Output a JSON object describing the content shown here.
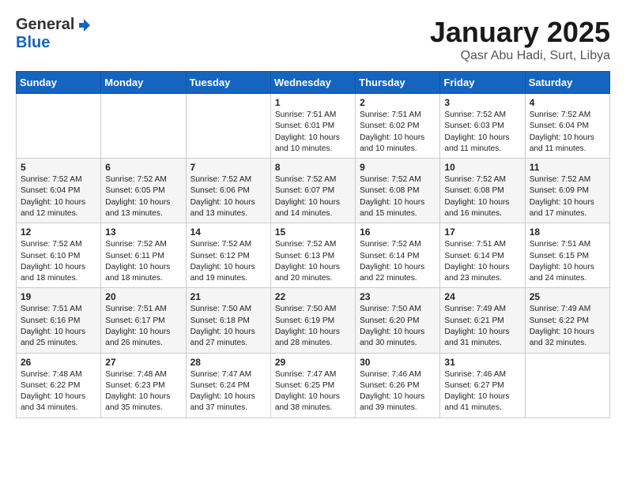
{
  "header": {
    "logo": {
      "general": "General",
      "blue": "Blue",
      "icon": "▶"
    },
    "title": "January 2025",
    "location": "Qasr Abu Hadi, Surt, Libya"
  },
  "calendar": {
    "days_of_week": [
      "Sunday",
      "Monday",
      "Tuesday",
      "Wednesday",
      "Thursday",
      "Friday",
      "Saturday"
    ],
    "weeks": [
      [
        {
          "day": "",
          "info": ""
        },
        {
          "day": "",
          "info": ""
        },
        {
          "day": "",
          "info": ""
        },
        {
          "day": "1",
          "info": "Sunrise: 7:51 AM\nSunset: 6:01 PM\nDaylight: 10 hours\nand 10 minutes."
        },
        {
          "day": "2",
          "info": "Sunrise: 7:51 AM\nSunset: 6:02 PM\nDaylight: 10 hours\nand 10 minutes."
        },
        {
          "day": "3",
          "info": "Sunrise: 7:52 AM\nSunset: 6:03 PM\nDaylight: 10 hours\nand 11 minutes."
        },
        {
          "day": "4",
          "info": "Sunrise: 7:52 AM\nSunset: 6:04 PM\nDaylight: 10 hours\nand 11 minutes."
        }
      ],
      [
        {
          "day": "5",
          "info": "Sunrise: 7:52 AM\nSunset: 6:04 PM\nDaylight: 10 hours\nand 12 minutes."
        },
        {
          "day": "6",
          "info": "Sunrise: 7:52 AM\nSunset: 6:05 PM\nDaylight: 10 hours\nand 13 minutes."
        },
        {
          "day": "7",
          "info": "Sunrise: 7:52 AM\nSunset: 6:06 PM\nDaylight: 10 hours\nand 13 minutes."
        },
        {
          "day": "8",
          "info": "Sunrise: 7:52 AM\nSunset: 6:07 PM\nDaylight: 10 hours\nand 14 minutes."
        },
        {
          "day": "9",
          "info": "Sunrise: 7:52 AM\nSunset: 6:08 PM\nDaylight: 10 hours\nand 15 minutes."
        },
        {
          "day": "10",
          "info": "Sunrise: 7:52 AM\nSunset: 6:08 PM\nDaylight: 10 hours\nand 16 minutes."
        },
        {
          "day": "11",
          "info": "Sunrise: 7:52 AM\nSunset: 6:09 PM\nDaylight: 10 hours\nand 17 minutes."
        }
      ],
      [
        {
          "day": "12",
          "info": "Sunrise: 7:52 AM\nSunset: 6:10 PM\nDaylight: 10 hours\nand 18 minutes."
        },
        {
          "day": "13",
          "info": "Sunrise: 7:52 AM\nSunset: 6:11 PM\nDaylight: 10 hours\nand 18 minutes."
        },
        {
          "day": "14",
          "info": "Sunrise: 7:52 AM\nSunset: 6:12 PM\nDaylight: 10 hours\nand 19 minutes."
        },
        {
          "day": "15",
          "info": "Sunrise: 7:52 AM\nSunset: 6:13 PM\nDaylight: 10 hours\nand 20 minutes."
        },
        {
          "day": "16",
          "info": "Sunrise: 7:52 AM\nSunset: 6:14 PM\nDaylight: 10 hours\nand 22 minutes."
        },
        {
          "day": "17",
          "info": "Sunrise: 7:51 AM\nSunset: 6:14 PM\nDaylight: 10 hours\nand 23 minutes."
        },
        {
          "day": "18",
          "info": "Sunrise: 7:51 AM\nSunset: 6:15 PM\nDaylight: 10 hours\nand 24 minutes."
        }
      ],
      [
        {
          "day": "19",
          "info": "Sunrise: 7:51 AM\nSunset: 6:16 PM\nDaylight: 10 hours\nand 25 minutes."
        },
        {
          "day": "20",
          "info": "Sunrise: 7:51 AM\nSunset: 6:17 PM\nDaylight: 10 hours\nand 26 minutes."
        },
        {
          "day": "21",
          "info": "Sunrise: 7:50 AM\nSunset: 6:18 PM\nDaylight: 10 hours\nand 27 minutes."
        },
        {
          "day": "22",
          "info": "Sunrise: 7:50 AM\nSunset: 6:19 PM\nDaylight: 10 hours\nand 28 minutes."
        },
        {
          "day": "23",
          "info": "Sunrise: 7:50 AM\nSunset: 6:20 PM\nDaylight: 10 hours\nand 30 minutes."
        },
        {
          "day": "24",
          "info": "Sunrise: 7:49 AM\nSunset: 6:21 PM\nDaylight: 10 hours\nand 31 minutes."
        },
        {
          "day": "25",
          "info": "Sunrise: 7:49 AM\nSunset: 6:22 PM\nDaylight: 10 hours\nand 32 minutes."
        }
      ],
      [
        {
          "day": "26",
          "info": "Sunrise: 7:48 AM\nSunset: 6:22 PM\nDaylight: 10 hours\nand 34 minutes."
        },
        {
          "day": "27",
          "info": "Sunrise: 7:48 AM\nSunset: 6:23 PM\nDaylight: 10 hours\nand 35 minutes."
        },
        {
          "day": "28",
          "info": "Sunrise: 7:47 AM\nSunset: 6:24 PM\nDaylight: 10 hours\nand 37 minutes."
        },
        {
          "day": "29",
          "info": "Sunrise: 7:47 AM\nSunset: 6:25 PM\nDaylight: 10 hours\nand 38 minutes."
        },
        {
          "day": "30",
          "info": "Sunrise: 7:46 AM\nSunset: 6:26 PM\nDaylight: 10 hours\nand 39 minutes."
        },
        {
          "day": "31",
          "info": "Sunrise: 7:46 AM\nSunset: 6:27 PM\nDaylight: 10 hours\nand 41 minutes."
        },
        {
          "day": "",
          "info": ""
        }
      ]
    ]
  }
}
